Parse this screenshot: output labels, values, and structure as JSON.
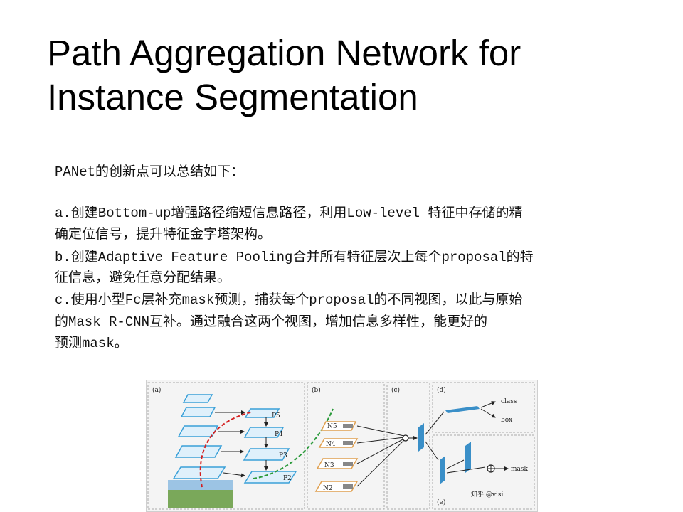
{
  "slide": {
    "title_line1": "Path Aggregation Network for",
    "title_line2": "Instance Segmentation"
  },
  "body": {
    "intro": "PANet的创新点可以总结如下：",
    "a_line1": "a.创建Bottom-up增强路径缩短信息路径，利用Low-level 特征中存储的精",
    "a_line2": "确定位信号，提升特征金字塔架构。",
    "b_line1": "b.创建Adaptive Feature Pooling合并所有特征层次上每个proposal的特",
    "b_line2": "征信息，避免任意分配结果。",
    "c_line1": "c.使用小型Fc层补充mask预测，捕获每个proposal的不同视图，以此与原始",
    "c_line2": "的Mask R-CNN互补。通过融合这两个视图，增加信息多样性，能更好的",
    "c_line3": "预测mask。"
  },
  "figure": {
    "panel_a": "(a)",
    "panel_b": "(b)",
    "panel_c": "(c)",
    "panel_d": "(d)",
    "panel_e": "(e)",
    "p5": "P5",
    "p4": "P4",
    "p3": "P3",
    "p2": "P2",
    "n5": "N5",
    "n4": "N4",
    "n3": "N3",
    "n2": "N2",
    "class_label": "class",
    "box_label": "box",
    "mask_label": "mask",
    "watermark": "知乎 @visi"
  },
  "colors": {
    "fpn_plane": "#3aa0d8",
    "bottom_up_plane": "#e0a050",
    "red_path": "#d42020",
    "green_path": "#2a9a3a",
    "head_block": "#3a8fc8"
  }
}
